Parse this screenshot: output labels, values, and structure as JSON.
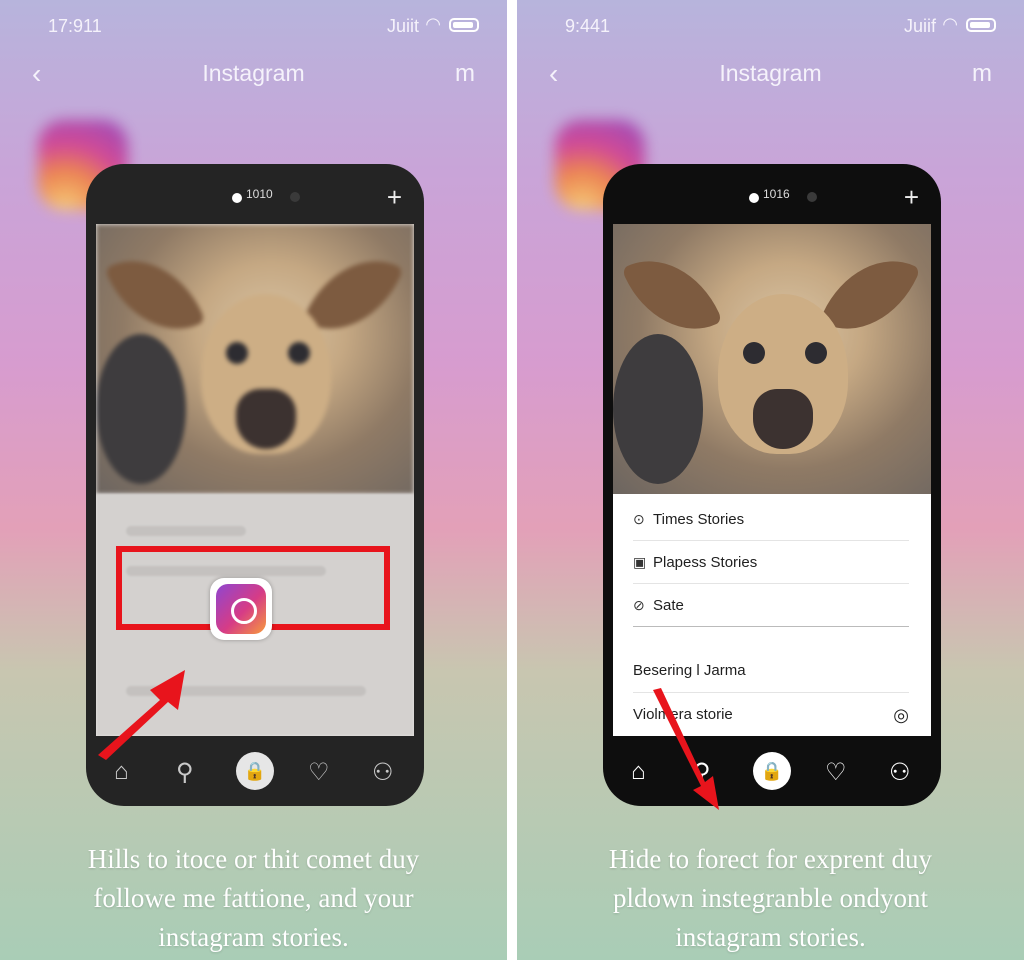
{
  "panels": [
    {
      "status": {
        "time": "17:911",
        "signal": "Juiit"
      },
      "nav": {
        "back": "‹",
        "title": "Instagram",
        "right": "m"
      },
      "phone": {
        "top_label": "1010",
        "plus": "+"
      },
      "tabs": {
        "home": "⌂",
        "search": "⚲",
        "center": "🔒",
        "heart": "♡",
        "profile": "⚇"
      },
      "caption": [
        "Hills to itoce or thit comet duy",
        "followe me fattione, and your",
        "instagram stories."
      ],
      "highlight_color": "#e8141c"
    },
    {
      "status": {
        "time": "9:441",
        "signal": "Juiif"
      },
      "nav": {
        "back": "‹",
        "title": "Instagram",
        "right": "m"
      },
      "phone": {
        "top_label": "1016",
        "plus": "+"
      },
      "menu": [
        {
          "icon": "timer-icon",
          "glyph": "⊙",
          "label": "Times Stories"
        },
        {
          "icon": "image-icon",
          "glyph": "▣",
          "label": "Plapess Stories"
        },
        {
          "icon": "clock-icon",
          "glyph": "⊘",
          "label": "Sate"
        },
        {
          "icon": "",
          "glyph": "",
          "label": "Besering l Jarma"
        },
        {
          "icon": "camera-icon",
          "glyph": "◎",
          "label": "Violmera storie"
        }
      ],
      "tabs": {
        "home": "⌂",
        "search": "⚲",
        "center": "🔒",
        "heart": "♡",
        "profile": "⚇"
      },
      "caption": [
        "Hide to forect for exprent duy",
        "pldown instegranble ondyont",
        "instagram stories."
      ],
      "arrow_color": "#e8141c"
    }
  ]
}
